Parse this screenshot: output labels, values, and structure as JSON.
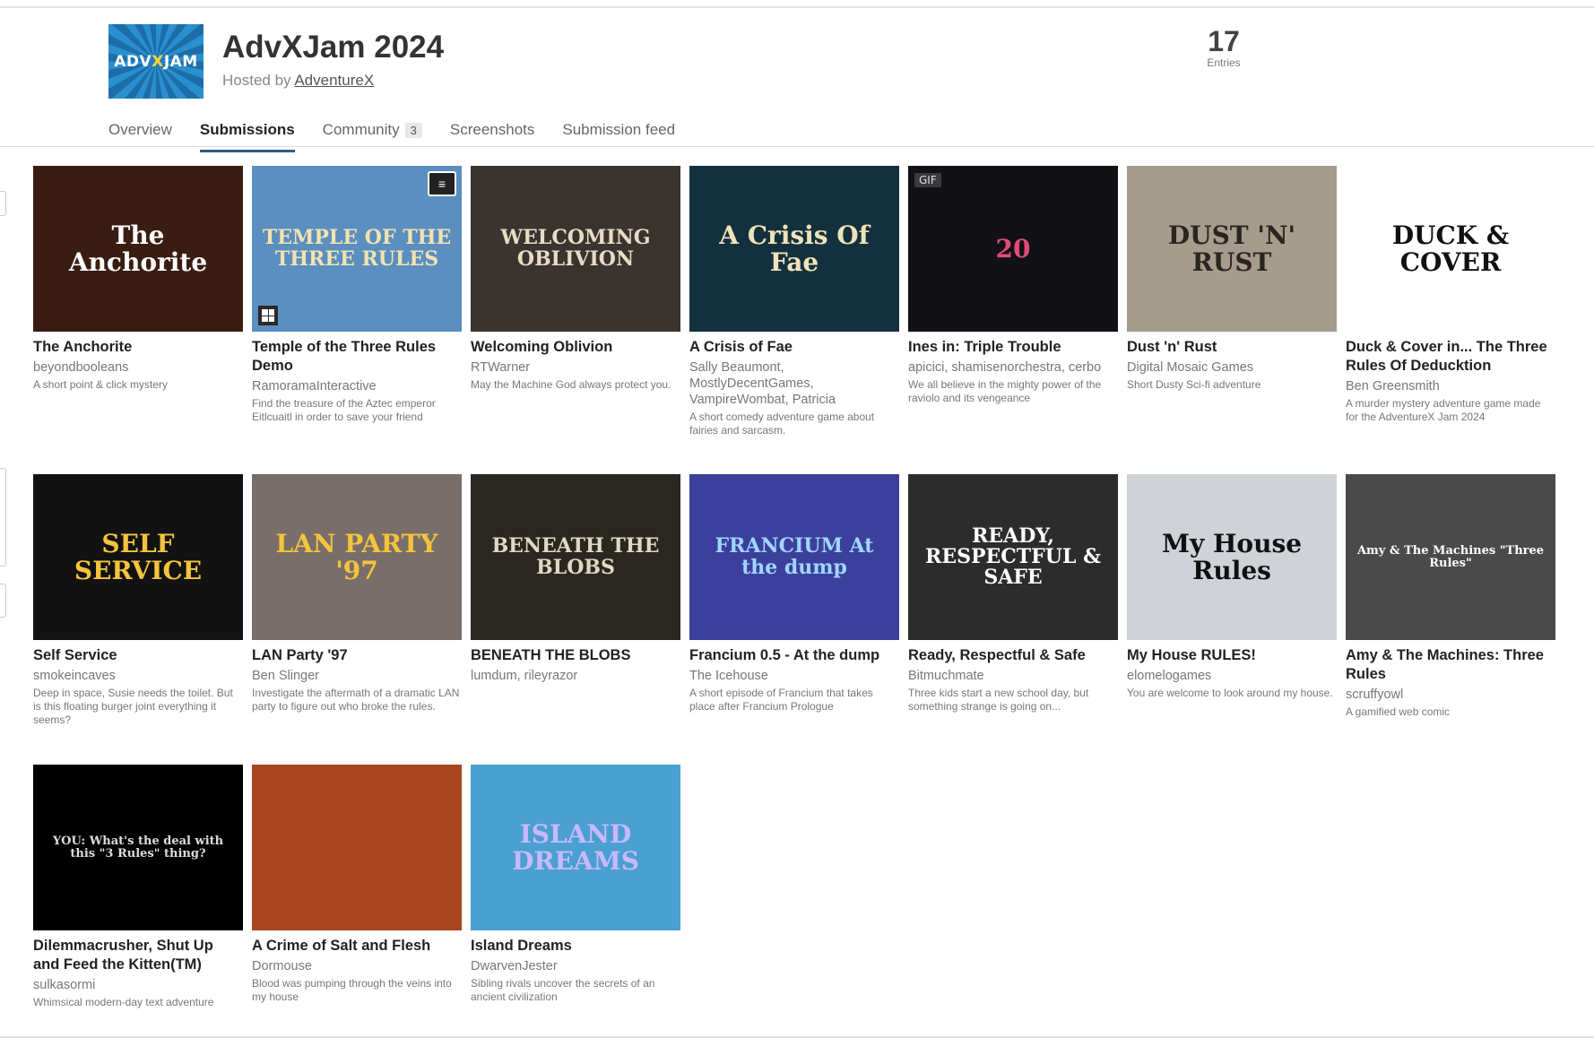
{
  "jam": {
    "logo_text_pre": "ADV",
    "logo_text_x": "X",
    "logo_text_post": "JAM",
    "title": "AdvXJam 2024",
    "hosted_prefix": "Hosted by ",
    "host": "AdventureX",
    "entries_count": "17",
    "entries_label": "Entries"
  },
  "tabs": [
    {
      "label": "Overview"
    },
    {
      "label": "Submissions",
      "active": true
    },
    {
      "label": "Community",
      "badge": "3"
    },
    {
      "label": "Screenshots"
    },
    {
      "label": "Submission feed"
    }
  ],
  "games": [
    {
      "title": "The Anchorite",
      "author": "beyondbooleans",
      "desc": "A short point & click mystery",
      "thumb_text": "The Anchorite",
      "bg": "#3a1d12",
      "fg": "#ffffff"
    },
    {
      "title": "Temple of the Three Rules Demo",
      "author": "RamoramaInteractive",
      "desc": "Find the treasure of the Aztec emperor Eitlcuaitl in order to save your friend",
      "thumb_text": "TEMPLE OF THE THREE RULES",
      "bg": "#5a8fc0",
      "fg": "#f3e3b0"
    },
    {
      "title": "Welcoming Oblivion",
      "author": "RTWarner",
      "desc": "May the Machine God always protect you.",
      "thumb_text": "WELCOMING OBLIVION",
      "bg": "#3a3430",
      "fg": "#e8dcc4"
    },
    {
      "title": "A Crisis of Fae",
      "author": "Sally Beaumont, MostlyDecentGames, VampireWombat, Patricia",
      "desc": "A short comedy adventure game about fairies and sarcasm.",
      "thumb_text": "A Crisis Of Fae",
      "bg": "#13303f",
      "fg": "#f0e2b8"
    },
    {
      "title": "Ines in: Triple Trouble",
      "author": "apicici, shamisenorchestra, cerbo",
      "desc": "We all believe in the mighty power of the raviolo and its vengeance",
      "thumb_text": "20",
      "bg": "#111116",
      "fg": "#e24a7a",
      "gif": "GIF"
    },
    {
      "title": "Dust 'n' Rust",
      "author": "Digital Mosaic Games",
      "desc": "Short Dusty Sci-fi adventure",
      "thumb_text": "DUST 'N' RUST",
      "bg": "#a59c8b",
      "fg": "#2b2521"
    },
    {
      "title": "Duck & Cover in... The Three Rules Of Deducktion",
      "author": "Ben Greensmith",
      "desc": "A murder mystery adventure game made for the AdventureX Jam 2024",
      "thumb_text": "DUCK & COVER",
      "bg": "#ffffff",
      "fg": "#111111"
    },
    {
      "title": "Self Service",
      "author": "smokeincaves",
      "desc": "Deep in space, Susie needs the toilet. But is this floating burger joint everything it seems?",
      "thumb_text": "SELF SERVICE",
      "bg": "#121212",
      "fg": "#f5c43c"
    },
    {
      "title": "LAN Party '97",
      "author": "Ben Slinger",
      "desc": "Investigate the aftermath of a dramatic LAN party to figure out who broke the rules.",
      "thumb_text": "LAN PARTY '97",
      "bg": "#7a6e6a",
      "fg": "#f4c43c"
    },
    {
      "title": "BENEATH THE BLOBS",
      "author": "lumdum, rileyrazor",
      "desc": "",
      "thumb_text": "BENEATH THE BLOBS",
      "bg": "#2a2620",
      "fg": "#e0d8c4"
    },
    {
      "title": "Francium 0.5 - At the dump",
      "author": "The Icehouse",
      "desc": "A short episode of Francium that takes place after Francium Prologue",
      "thumb_text": "FRANCIUM At the dump",
      "bg": "#3c3f9c",
      "fg": "#9fd6ff"
    },
    {
      "title": "Ready, Respectful & Safe",
      "author": "Bitmuchmate",
      "desc": "Three kids start a new school day, but something strange is going on...",
      "thumb_text": "READY, RESPECTFUL & SAFE",
      "bg": "#2c2c2c",
      "fg": "#ffffff"
    },
    {
      "title": "My House RULES!",
      "author": "elomelogames",
      "desc": "You are welcome to look around my house.",
      "thumb_text": "My House Rules",
      "bg": "#cfd3d8",
      "fg": "#111111"
    },
    {
      "title": "Amy & The Machines: Three Rules",
      "author": "scruffyowl",
      "desc": "A gamified web comic",
      "thumb_text": "Amy & The Machines \"Three Rules\"",
      "bg": "#4a4a4a",
      "fg": "#ffffff"
    },
    {
      "title": "Dilemmacrusher, Shut Up and Feed the Kitten(TM)",
      "author": "sulkasormi",
      "desc": "Whimsical modern-day text adventure",
      "thumb_text": "YOU: What's the deal with this \"3 Rules\" thing?",
      "bg": "#000000",
      "fg": "#dddddd"
    },
    {
      "title": "A Crime of Salt and Flesh",
      "author": "Dormouse",
      "desc": "Blood was pumping through the veins into my house",
      "thumb_text": "",
      "bg": "#a8451f",
      "fg": "#ffffff"
    },
    {
      "title": "Island Dreams",
      "author": "DwarvenJester",
      "desc": "Sibling rivals uncover the secrets of an ancient civilization",
      "thumb_text": "ISLAND DREAMS",
      "bg": "#4aa0d0",
      "fg": "#c9b8ff"
    }
  ]
}
